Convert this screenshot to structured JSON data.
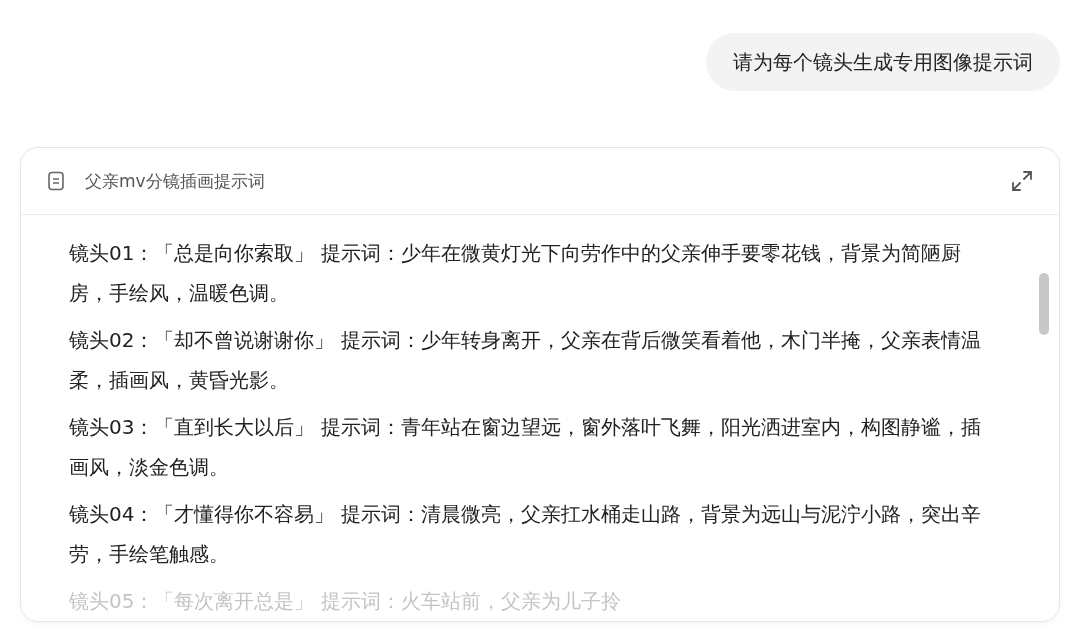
{
  "user_message": "请为每个镜头生成专用图像提示词",
  "document": {
    "title": "父亲mv分镜插画提示词",
    "paragraphs": [
      {
        "text": "镜头01：「总是向你索取」 提示词：少年在微黄灯光下向劳作中的父亲伸手要零花钱，背景为简陋厨房，手绘风，温暖色调。",
        "faded": false
      },
      {
        "text": "镜头02：「却不曾说谢谢你」 提示词：少年转身离开，父亲在背后微笑看着他，木门半掩，父亲表情温柔，插画风，黄昏光影。",
        "faded": false
      },
      {
        "text": "镜头03：「直到长大以后」 提示词：青年站在窗边望远，窗外落叶飞舞，阳光洒进室内，构图静谧，插画风，淡金色调。",
        "faded": false
      },
      {
        "text": "镜头04：「才懂得你不容易」 提示词：清晨微亮，父亲扛水桶走山路，背景为远山与泥泞小路，突出辛劳，手绘笔触感。",
        "faded": false
      },
      {
        "text": "镜头05：「每次离开总是」 提示词：火车站前，父亲为儿子拎",
        "faded": true
      }
    ]
  }
}
